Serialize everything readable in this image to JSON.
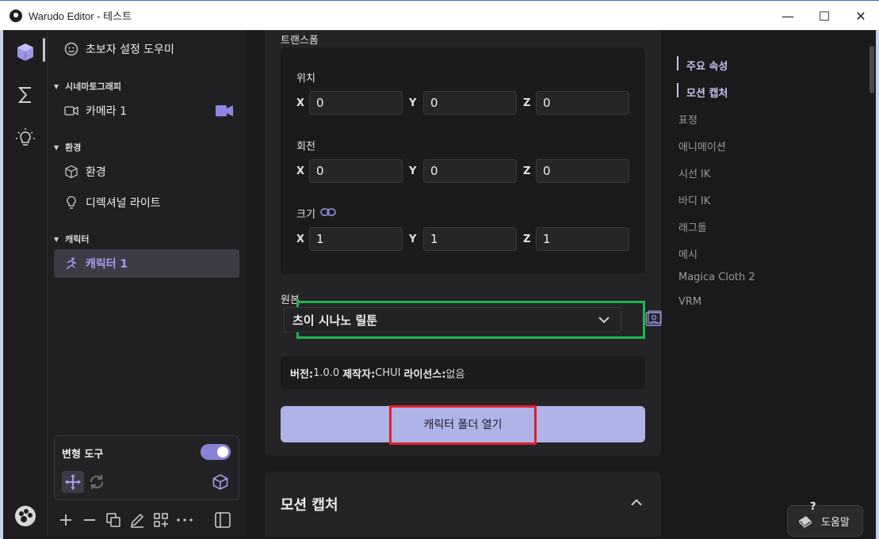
{
  "window": {
    "title": "Warudo Editor - 테스트",
    "minimize": "—",
    "maximize": "☐",
    "close": "✕"
  },
  "sidebar": {
    "wizard_label": "초보자 설정 도우미",
    "sections": [
      {
        "label": "시네마토그래피",
        "items": [
          {
            "label": "카메라 1"
          }
        ]
      },
      {
        "label": "환경",
        "items": [
          {
            "label": "환경"
          },
          {
            "label": "디렉셔널 라이트"
          }
        ]
      },
      {
        "label": "캐릭터",
        "items": [
          {
            "label": "캐릭터 1"
          }
        ]
      }
    ],
    "transform_tool_label": "변형 도구",
    "transform_tool_enabled": true
  },
  "main": {
    "transform_heading": "트랜스폼",
    "position_label": "위치",
    "rotation_label": "회전",
    "scale_label": "크기",
    "axes": [
      "X",
      "Y",
      "Z"
    ],
    "position": [
      "0",
      "0",
      "0"
    ],
    "rotation": [
      "0",
      "0",
      "0"
    ],
    "scale": [
      "1",
      "1",
      "1"
    ],
    "source_label": "원본",
    "source_value": "츠이 시나노 릴툰",
    "info": {
      "version_key": "버전:",
      "version_val": "1.0.0",
      "author_key": "제작자:",
      "author_val": "CHUI",
      "license_key": "라이선스:",
      "license_val": "없음"
    },
    "open_folder_button": "캐릭터 폴더 열기",
    "motion_capture_title": "모션 캡처"
  },
  "toc": {
    "items": [
      "주요 속성",
      "모션 캡처",
      "표정",
      "애니메이션",
      "시선 IK",
      "바디 IK",
      "래그돌",
      "메시",
      "Magica Cloth 2",
      "VRM"
    ],
    "active": [
      "주요 속성",
      "모션 캡처"
    ]
  },
  "help": {
    "label": "도움말",
    "badge": "?"
  },
  "colors": {
    "accent": "#8a82d8",
    "button": "#aeb3e8",
    "highlight_green": "#1fb64a",
    "highlight_red": "#e0202a"
  }
}
